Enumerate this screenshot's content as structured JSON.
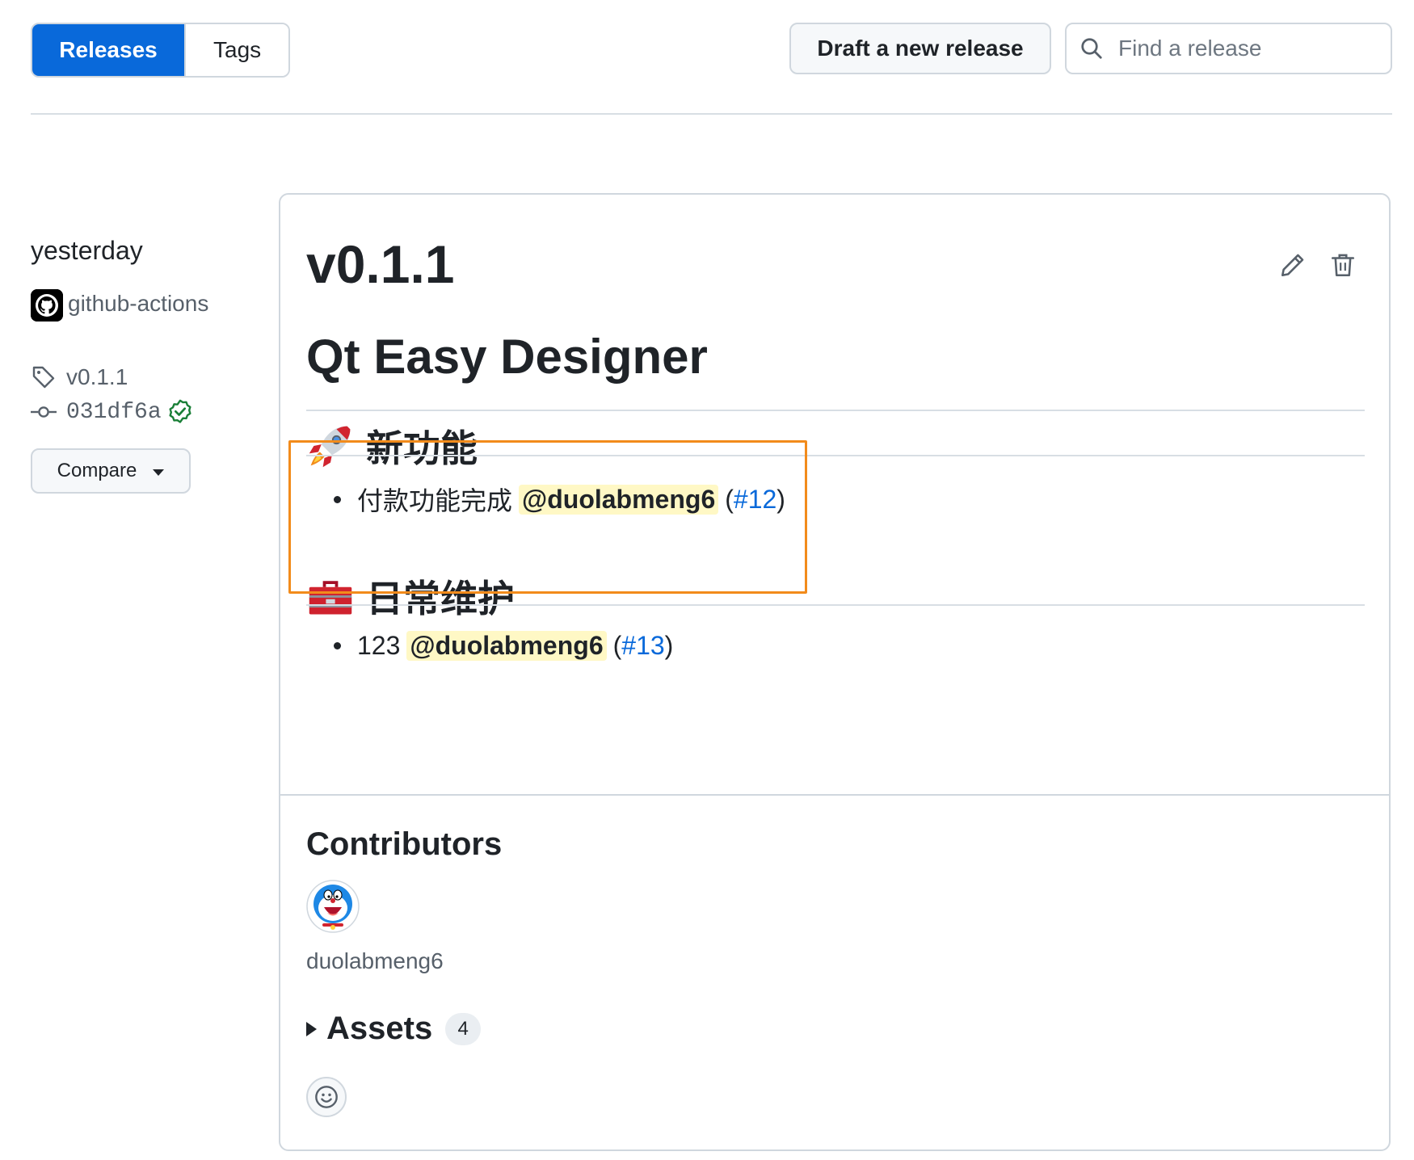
{
  "nav": {
    "tabs": [
      {
        "label": "Releases",
        "active": true
      },
      {
        "label": "Tags",
        "active": false
      }
    ],
    "draft_button": "Draft a new release",
    "search": {
      "placeholder": "Find a release",
      "value": ""
    }
  },
  "sidebar": {
    "when": "yesterday",
    "author": "github-actions",
    "tag": "v0.1.1",
    "commit": "031df6a",
    "compare_label": "Compare"
  },
  "release": {
    "version": "v0.1.1",
    "title": "Qt Easy Designer",
    "sections": [
      {
        "emoji": "rocket-icon",
        "heading": "新功能",
        "items": [
          {
            "text": "付款功能完成",
            "mention": "@duolabmeng6",
            "pr_open": "(",
            "pr": "#12",
            "pr_close": ")"
          }
        ]
      },
      {
        "emoji": "toolbox-icon",
        "heading": "日常维护",
        "items": [
          {
            "text": "123",
            "mention": "@duolabmeng6",
            "pr_open": "(",
            "pr": "#13",
            "pr_close": ")"
          }
        ]
      }
    ],
    "contributors_title": "Contributors",
    "contributors": [
      {
        "name": "duolabmeng6"
      }
    ],
    "assets_label": "Assets",
    "assets_count": "4"
  },
  "colors": {
    "accent": "#0969da",
    "verified": "#1a7f37",
    "highlight_box": "#f28b1b",
    "mention_bg": "#fff8c5"
  }
}
